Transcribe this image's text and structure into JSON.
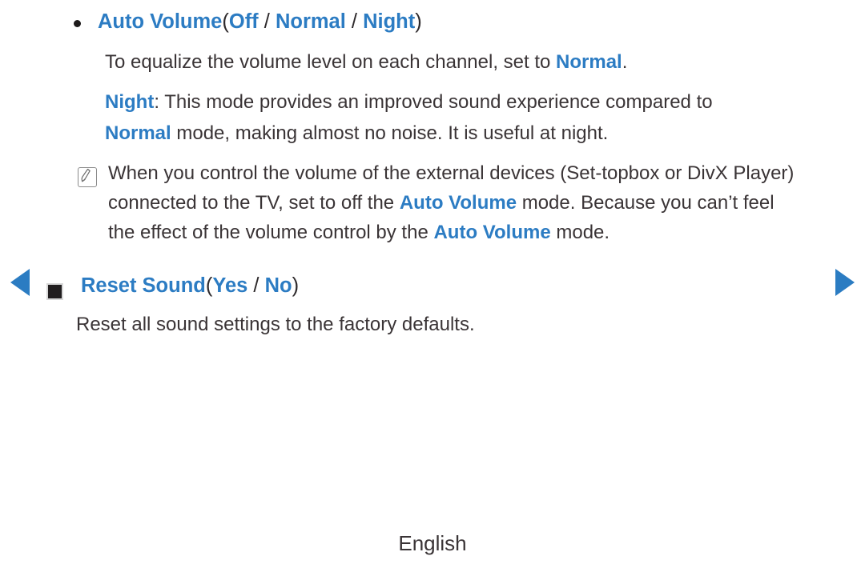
{
  "page": {
    "language_footer": "English",
    "accent_color": "#2c7cc3",
    "text_color": "#3a3436"
  },
  "sections": [
    {
      "id": "auto-volume",
      "marker": "bullet-dot",
      "heading": {
        "term": "Auto Volume",
        "open_paren": "(",
        "options": [
          "Off",
          "Normal",
          "Night"
        ],
        "separator": " / ",
        "close_paren": ")"
      },
      "paragraphs": [
        {
          "id": "equalize",
          "parts": [
            {
              "text": "To equalize the volume level on each channel, set to ",
              "style": "normal"
            },
            {
              "text": "Normal",
              "style": "accent"
            },
            {
              "text": ".",
              "style": "normal"
            }
          ]
        },
        {
          "id": "night-mode",
          "parts": [
            {
              "text": "Night",
              "style": "accent"
            },
            {
              "text": ": This mode provides an improved sound experience compared to ",
              "style": "normal"
            },
            {
              "text": "Normal",
              "style": "accent"
            },
            {
              "text": " mode, making almost no noise. It is useful at night.",
              "style": "normal"
            }
          ]
        }
      ],
      "note": {
        "icon": "note-pencil-icon",
        "parts": [
          {
            "text": "When you control the volume of the external devices (Set-topbox or DivX Player) connected to the TV, set to off the ",
            "style": "normal"
          },
          {
            "text": "Auto Volume",
            "style": "accent"
          },
          {
            "text": " mode. Because you can’t feel the effect of the volume control by the ",
            "style": "normal"
          },
          {
            "text": "Auto Volume",
            "style": "accent"
          },
          {
            "text": " mode.",
            "style": "normal"
          }
        ]
      }
    },
    {
      "id": "reset-sound",
      "marker": "square",
      "heading": {
        "term": "Reset Sound",
        "open_paren": "(",
        "options": [
          "Yes",
          "No"
        ],
        "separator": " / ",
        "close_paren": ")"
      },
      "paragraphs": [
        {
          "id": "reset-desc",
          "parts": [
            {
              "text": "Reset all sound settings to the factory defaults.",
              "style": "normal"
            }
          ]
        }
      ]
    }
  ],
  "navigation": {
    "previous_page_label": "◀",
    "next_page_label": "▶"
  }
}
